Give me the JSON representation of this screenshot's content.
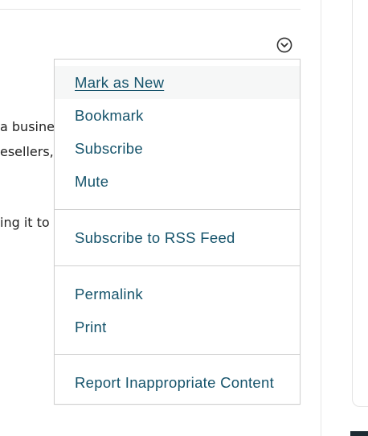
{
  "background_text": {
    "line1": "a business",
    "line2": "esellers, c",
    "line3": "ing it to r"
  },
  "options_button": {
    "icon": "chevron-down-circle-icon"
  },
  "menu": {
    "items": [
      {
        "label": "Mark as New"
      },
      {
        "label": "Bookmark"
      },
      {
        "label": "Subscribe"
      },
      {
        "label": "Mute"
      },
      {
        "label": "Subscribe to RSS Feed"
      },
      {
        "label": "Permalink"
      },
      {
        "label": "Print"
      },
      {
        "label": "Report Inappropriate Content"
      }
    ]
  },
  "colors": {
    "menu_text": "#15536b",
    "menu_border": "#cfcfcf",
    "active_bg": "#f6f7f7",
    "dark_block": "#1d2b33"
  }
}
